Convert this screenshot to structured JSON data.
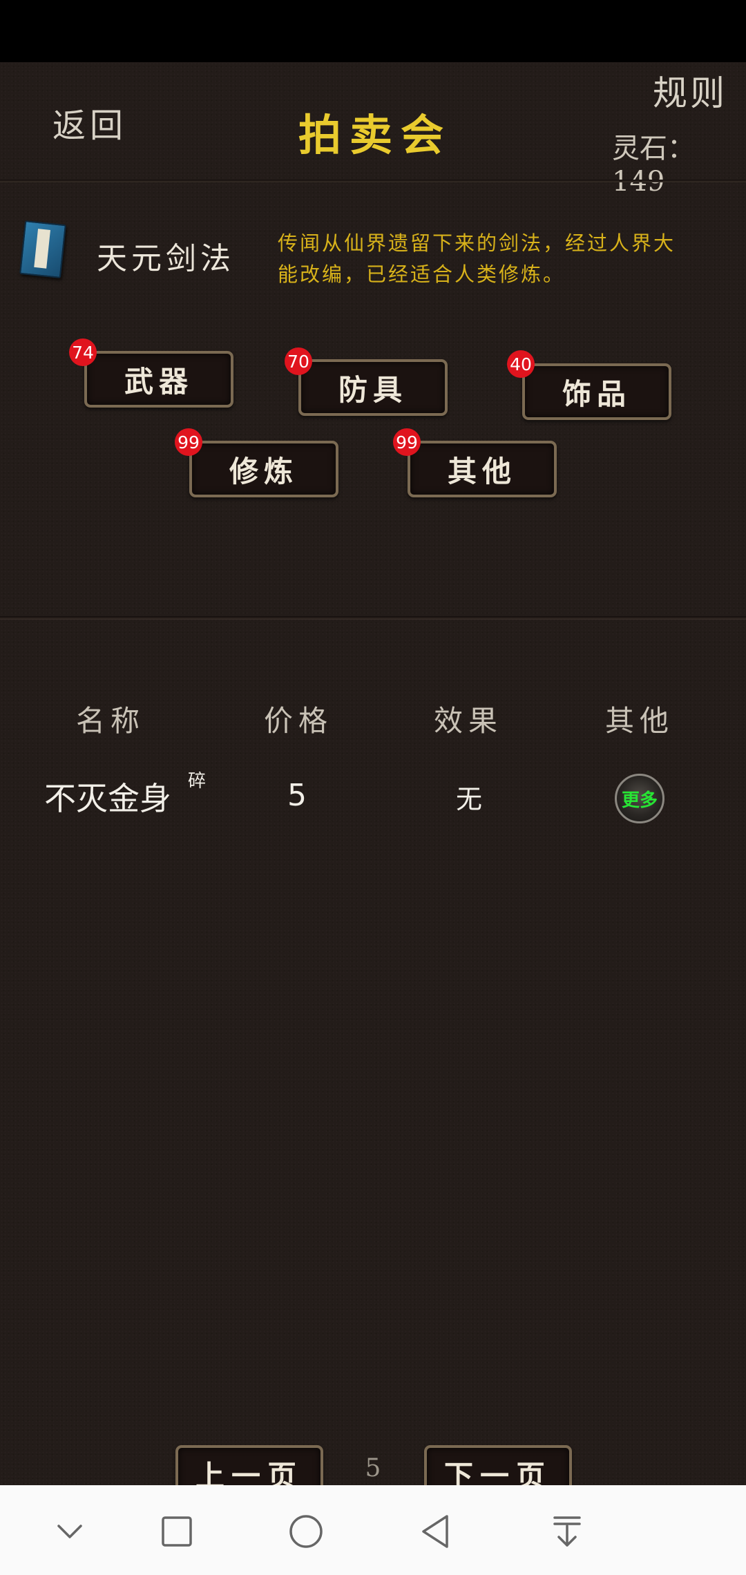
{
  "header": {
    "back_label": "返回",
    "title": "拍卖会",
    "rules_label": "规则",
    "currency": "灵石：149"
  },
  "featured_item": {
    "icon": "manual-book-icon",
    "name": "天元剑法",
    "description": "传闻从仙界遗留下来的剑法，经过人界大能改编，已经适合人类修炼。"
  },
  "categories": [
    {
      "label": "武器",
      "count": "74"
    },
    {
      "label": "防具",
      "count": "70"
    },
    {
      "label": "饰品",
      "count": "40"
    },
    {
      "label": "修炼",
      "count": "99"
    },
    {
      "label": "其他",
      "count": "99"
    }
  ],
  "table": {
    "columns": [
      "名称",
      "价格",
      "效果",
      "其他"
    ],
    "rows": [
      {
        "name": "不灭金身",
        "fragment_mark": "碎",
        "price": "5",
        "effect": "无",
        "more_label": "更多"
      }
    ]
  },
  "pagination": {
    "prev_label": "上一页",
    "page": "5",
    "next_label": "下一页"
  },
  "colors": {
    "title": "#e9cb2e",
    "description": "#d8b21a",
    "badge": "#e0141e",
    "more_text": "#27e534"
  }
}
